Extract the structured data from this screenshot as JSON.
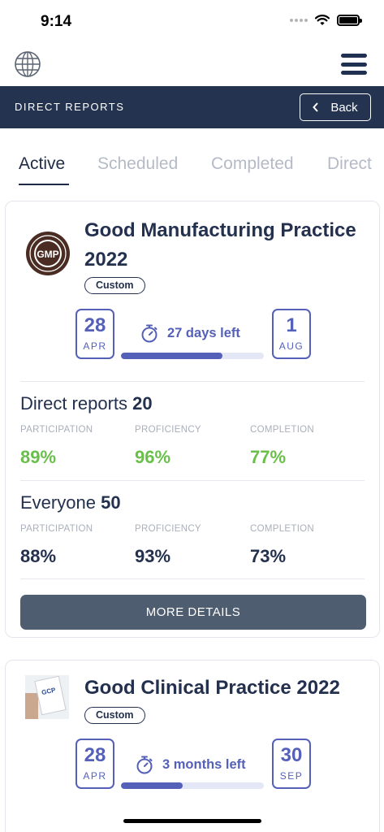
{
  "status_bar": {
    "time": "9:14"
  },
  "nav": {
    "title": "DIRECT REPORTS",
    "back_label": "Back"
  },
  "tabs": [
    {
      "label": "Active"
    },
    {
      "label": "Scheduled"
    },
    {
      "label": "Completed"
    },
    {
      "label": "Direct"
    }
  ],
  "cards": [
    {
      "logo_text": "GMP",
      "title": "Good Manufacturing Practice 2022",
      "badge": "Custom",
      "start": {
        "day": "28",
        "month": "APR"
      },
      "end": {
        "day": "1",
        "month": "AUG"
      },
      "countdown": "27 days left",
      "progress": 0.71,
      "direct_reports": {
        "label": "Direct reports",
        "count": "20",
        "stats": [
          {
            "label": "PARTICIPATION",
            "value": "89%"
          },
          {
            "label": "PROFICIENCY",
            "value": "96%"
          },
          {
            "label": "COMPLETION",
            "value": "77%"
          }
        ]
      },
      "everyone": {
        "label": "Everyone",
        "count": "50",
        "stats": [
          {
            "label": "PARTICIPATION",
            "value": "88%"
          },
          {
            "label": "PROFICIENCY",
            "value": "93%"
          },
          {
            "label": "COMPLETION",
            "value": "73%"
          }
        ]
      },
      "more_label": "MORE DETAILS"
    },
    {
      "logo_text": "GCP",
      "title": "Good Clinical Practice 2022",
      "badge": "Custom",
      "start": {
        "day": "28",
        "month": "APR"
      },
      "end": {
        "day": "30",
        "month": "SEP"
      },
      "countdown": "3 months left",
      "progress": 0.43
    }
  ],
  "colors": {
    "navy": "#233350",
    "accent": "#5560b8",
    "green": "#6abf4b",
    "button": "#4f5d71"
  }
}
